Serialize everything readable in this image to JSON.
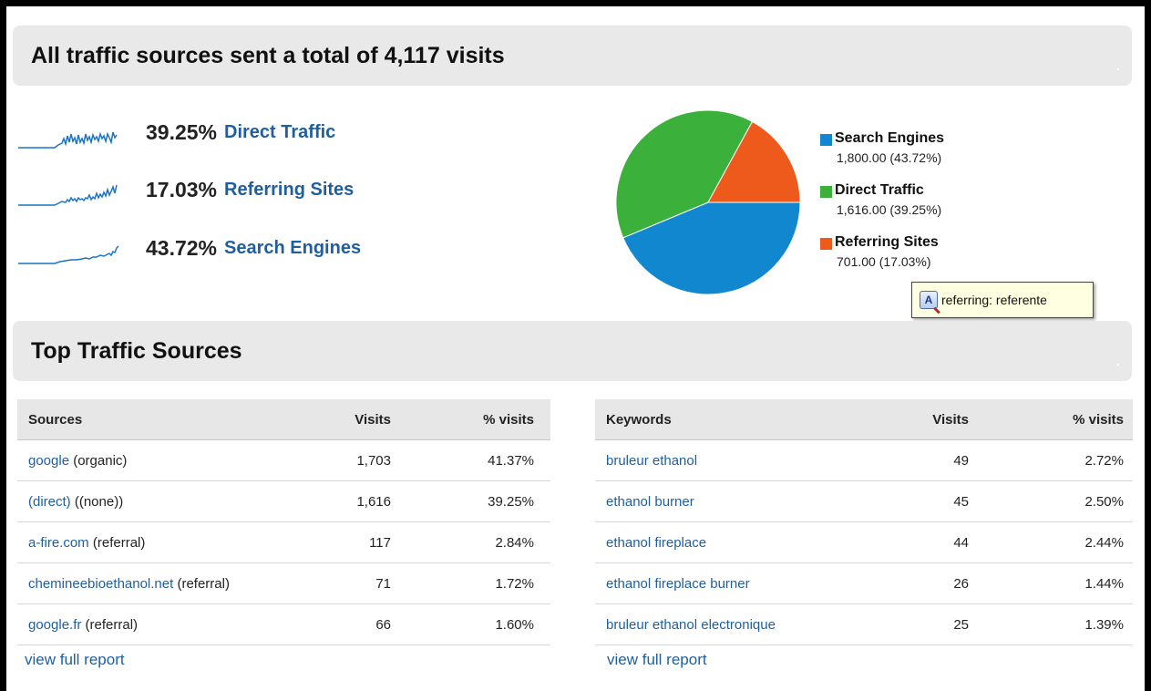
{
  "summary": {
    "title": "All traffic sources sent a total of 4,117 visits",
    "rows": [
      {
        "percent": "39.25%",
        "label": "Direct Traffic"
      },
      {
        "percent": "17.03%",
        "label": "Referring Sites"
      },
      {
        "percent": "43.72%",
        "label": "Search Engines"
      }
    ]
  },
  "chart_data": {
    "type": "pie",
    "slices": [
      {
        "name": "Search Engines",
        "value": 1800.0,
        "display": "1,800.00 (43.72%)",
        "color": "#1187cf"
      },
      {
        "name": "Direct Traffic",
        "value": 1616.0,
        "display": "1,616.00 (39.25%)",
        "color": "#3bb13b"
      },
      {
        "name": "Referring Sites",
        "value": 701.0,
        "display": "701.00 (17.03%)",
        "color": "#ed5a1c"
      }
    ],
    "legend_position": "right"
  },
  "tooltip": {
    "text": "referring: referente"
  },
  "top": {
    "title": "Top Traffic Sources"
  },
  "sources": {
    "headers": {
      "name": "Sources",
      "visits": "Visits",
      "pct": "% visits"
    },
    "rows": [
      {
        "link": "google",
        "note": " (organic)",
        "visits": "1,703",
        "pct": "41.37%"
      },
      {
        "link": "(direct)",
        "note": " ((none))",
        "visits": "1,616",
        "pct": "39.25%"
      },
      {
        "link": "a-fire.com",
        "note": " (referral)",
        "visits": "117",
        "pct": "2.84%"
      },
      {
        "link": "chemineebioethanol.net",
        "note": " (referral)",
        "visits": "71",
        "pct": "1.72%"
      },
      {
        "link": "google.fr",
        "note": " (referral)",
        "visits": "66",
        "pct": "1.60%"
      }
    ],
    "view_full": "view full report"
  },
  "keywords": {
    "headers": {
      "name": "Keywords",
      "visits": "Visits",
      "pct": "% visits"
    },
    "rows": [
      {
        "link": "bruleur ethanol",
        "visits": "49",
        "pct": "2.72%"
      },
      {
        "link": "ethanol burner",
        "visits": "45",
        "pct": "2.50%"
      },
      {
        "link": "ethanol fireplace",
        "visits": "44",
        "pct": "2.44%"
      },
      {
        "link": "ethanol fireplace burner",
        "visits": "26",
        "pct": "1.44%"
      },
      {
        "link": "bruleur ethanol electronique",
        "visits": "25",
        "pct": "1.39%"
      }
    ],
    "view_full": "view full report"
  },
  "colors": {
    "link": "#1f5f9f",
    "sparkline": "#1a73c7",
    "header_bg": "#e9e9e9"
  }
}
